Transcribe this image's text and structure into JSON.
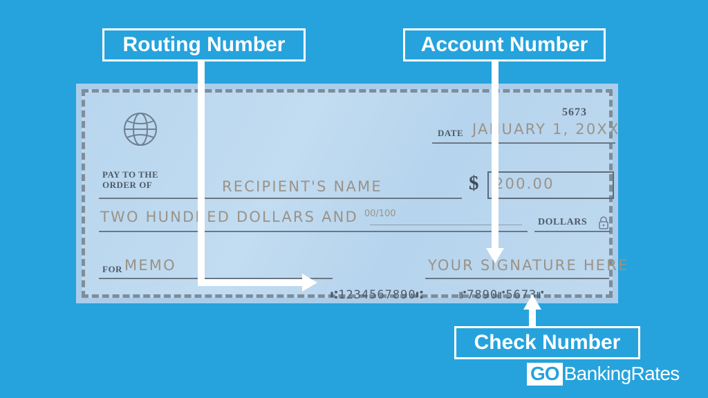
{
  "background_color": "#26a3dd",
  "check": {
    "paper_color": "#bcd8ef",
    "border_color": "#7f8d99",
    "bank_icon": "globe-icon",
    "check_number_top_right": "5673",
    "date_label": "DATE",
    "date_value": "JANUARY 1, 20XX",
    "pay_to_label_line1": "PAY TO THE",
    "pay_to_label_line2": "ORDER OF",
    "payee_value": "RECIPIENT'S NAME",
    "dollar_sign": "$",
    "amount_numeric": "200.00",
    "amount_words": "TWO HUNDRED DOLLARS AND ",
    "amount_words_fraction_top": "00",
    "amount_words_fraction_slash": "/",
    "amount_words_fraction_bottom": "100",
    "dollars_label": "DOLLARS",
    "security_icon": "lock-icon",
    "for_label": "FOR",
    "memo_value": "MEMO",
    "signature_value": "YOUR SIGNATURE HERE",
    "micr_routing": "⑆1234567890⑆",
    "micr_account_check": "⑈7890⑈5673⑈",
    "routing_number": "1234567890",
    "account_number": "7890",
    "micr_check_number": "5673"
  },
  "callouts": {
    "routing": "Routing Number",
    "account": "Account Number",
    "check": "Check Number"
  },
  "logo": {
    "mark": "GO",
    "wordmark": "BankingRates",
    "mark_color": "#26a3dd",
    "wordmark_color": "#ffffff"
  }
}
